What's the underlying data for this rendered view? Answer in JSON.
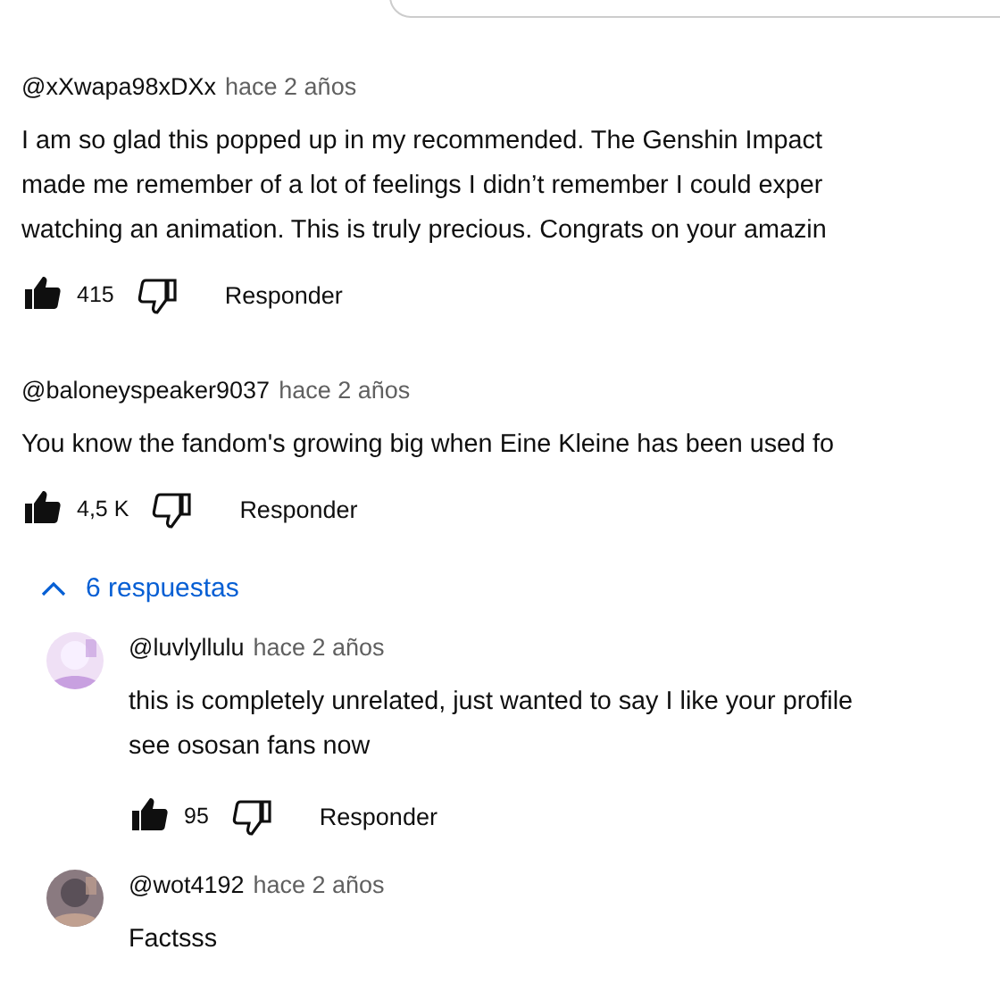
{
  "comment_box": {
    "kind": "outline"
  },
  "comments": [
    {
      "author": "@xXwapa98xDXx",
      "time": "hace 2 años",
      "lines": [
        "I am so glad this popped up in my recommended. The Genshin Impact",
        "made me remember of a lot of feelings I didn’t remember I could exper",
        "watching an animation. This is truly precious. Congrats on your amazin"
      ],
      "likes": "415",
      "liked": true,
      "disliked": false,
      "reply_label": "Responder"
    },
    {
      "author": "@baloneyspeaker9037",
      "time": "hace 2 años",
      "lines": [
        "You know the fandom's growing big when Eine Kleine has been used fo"
      ],
      "likes": "4,5 K",
      "liked": true,
      "disliked": false,
      "reply_label": "Responder",
      "replies_toggle": {
        "label": "6 respuestas",
        "expanded": true
      },
      "replies": [
        {
          "author": "@luvlyllulu",
          "time": "hace 2 años",
          "avatar": {
            "kind": "picture"
          },
          "lines": [
            "this is completely unrelated, just wanted to say I like your profile",
            "see ososan fans now"
          ],
          "likes": "95",
          "liked": true,
          "disliked": false,
          "reply_label": "Responder"
        },
        {
          "author": "@wot4192",
          "time": "hace 2 años",
          "avatar": {
            "kind": "picture"
          },
          "lines": [
            "Factsss"
          ]
        }
      ]
    }
  ]
}
